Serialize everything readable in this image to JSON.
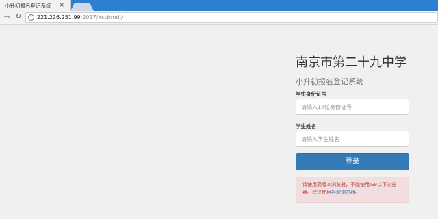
{
  "browser": {
    "tab_title": "小升初报名登记系统",
    "tab_close": "×",
    "url_host": "221.226.251.99",
    "url_rest": ":2017/xscbmdj/"
  },
  "page": {
    "school_title": "南京市第二十九中学",
    "system_title": "小升初报名登记系统",
    "id_label": "学生身份证号",
    "id_placeholder": "请输入18位身份证号",
    "name_label": "学生姓名",
    "name_placeholder": "请输入学生姓名",
    "login_label": "登录",
    "alert_text_before": "请使用高版本浏览器，不能使用IE9以下浏览器。建议使用",
    "alert_link_text": "谷歌浏览器",
    "alert_text_after": "。"
  },
  "colors": {
    "primary": "#337ab7",
    "alert_bg": "#f2dede",
    "alert_text": "#a94442",
    "chrome_blue": "#2f7fd1"
  }
}
